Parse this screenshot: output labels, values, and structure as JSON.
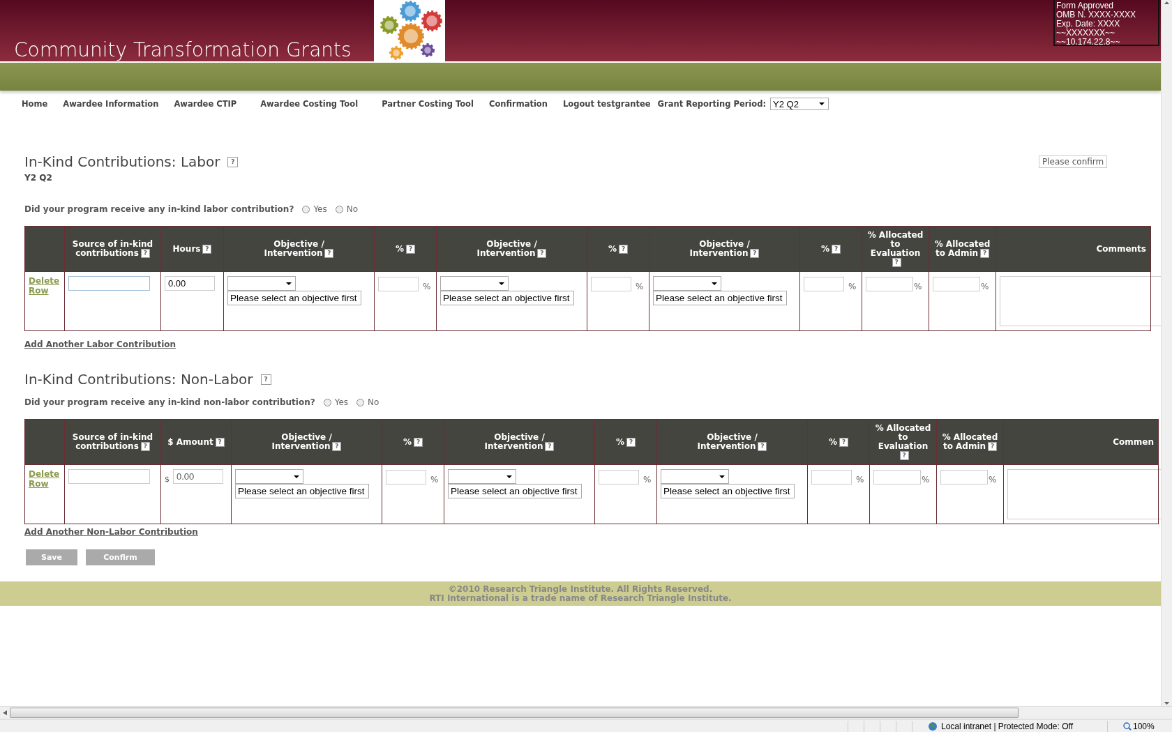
{
  "header": {
    "title": "Community Transformation Grants",
    "form_info": [
      "Form Approved",
      "OMB N. XXXX-XXXX",
      "Exp. Date: XXXX",
      "~~XXXXXXX~~",
      "~~10.174.22.8~~"
    ]
  },
  "nav": {
    "items": [
      {
        "label": "Home"
      },
      {
        "label": "Awardee Information"
      },
      {
        "label": "Awardee CTIP"
      },
      {
        "label": "Awardee Costing Tool"
      },
      {
        "label": "Partner Costing Tool"
      },
      {
        "label": "Confirmation"
      },
      {
        "label": "Logout testgrantee"
      }
    ],
    "period_label": "Grant Reporting Period:",
    "period_value": "Y2 Q2"
  },
  "confirm_notice": "Please confirm",
  "sections": [
    {
      "title": "In-Kind Contributions: Labor",
      "help": "?",
      "subtitle": "Y2 Q2",
      "question": "Did your program receive any in-kind labor contribution?",
      "options": [
        {
          "label": "Yes",
          "selected": false
        },
        {
          "label": "No",
          "selected": false
        }
      ],
      "columns": [
        {
          "label": "Source of in-kind contributions",
          "help": "?"
        },
        {
          "label": "Hours",
          "help": "?"
        },
        {
          "label": "Objective / Intervention",
          "help": "?"
        },
        {
          "label": "%",
          "help": "?"
        },
        {
          "label": "Objective / Intervention",
          "help": "?"
        },
        {
          "label": "%",
          "help": "?"
        },
        {
          "label": "Objective / Intervention",
          "help": "?"
        },
        {
          "label": "%",
          "help": "?"
        },
        {
          "label": "% Allocated to Evaluation",
          "help": "?"
        },
        {
          "label": "% Allocated to Admin",
          "help": "?"
        },
        {
          "label": "Comments"
        }
      ],
      "rows": [
        {
          "action": "Delete Row",
          "cells": [
            {
              "kind": "text",
              "focused": true
            },
            {
              "kind": "number",
              "value": "0.00"
            },
            {
              "kind": "objective",
              "value": "Please select an objective first"
            },
            {
              "kind": "percent",
              "unit": "%"
            },
            {
              "kind": "objective",
              "value": "Please select an objective first"
            },
            {
              "kind": "percent",
              "unit": "%"
            },
            {
              "kind": "objective",
              "value": "Please select an objective first"
            },
            {
              "kind": "percent",
              "unit": "%"
            },
            {
              "kind": "allocation",
              "unit": "%"
            },
            {
              "kind": "allocation",
              "unit": "%"
            },
            {
              "kind": "comments"
            }
          ]
        }
      ],
      "add_link": "Add Another Labor Contribution"
    },
    {
      "title": "In-Kind Contributions: Non-Labor",
      "help": "?",
      "question": "Did your program receive any in-kind non-labor contribution?",
      "options": [
        {
          "label": "Yes",
          "selected": false
        },
        {
          "label": "No",
          "selected": false
        }
      ],
      "columns": [
        {
          "label": "Source of in-kind contributions",
          "help": "?"
        },
        {
          "label": "$ Amount",
          "help": "?"
        },
        {
          "label": "Objective / Intervention",
          "help": "?"
        },
        {
          "label": "%",
          "help": "?"
        },
        {
          "label": "Objective / Intervention",
          "help": "?"
        },
        {
          "label": "%",
          "help": "?"
        },
        {
          "label": "Objective / Intervention",
          "help": "?"
        },
        {
          "label": "%",
          "help": "?"
        },
        {
          "label": "% Allocated to Evaluation",
          "help": "?"
        },
        {
          "label": "% Allocated to Admin",
          "help": "?"
        },
        {
          "label": "Commen"
        }
      ],
      "rows": [
        {
          "action": "Delete Row",
          "cells": [
            {
              "kind": "text",
              "focused": false
            },
            {
              "kind": "money",
              "prefix": "$",
              "value": "0.00"
            },
            {
              "kind": "objective",
              "value": "Please select an objective first"
            },
            {
              "kind": "percent",
              "unit": "%"
            },
            {
              "kind": "objective",
              "value": "Please select an objective first"
            },
            {
              "kind": "percent",
              "unit": "%"
            },
            {
              "kind": "objective",
              "value": "Please select an objective first"
            },
            {
              "kind": "percent",
              "unit": "%"
            },
            {
              "kind": "allocation",
              "unit": "%"
            },
            {
              "kind": "allocation",
              "unit": "%"
            },
            {
              "kind": "comments"
            }
          ]
        }
      ],
      "add_link": "Add Another Non-Labor Contribution"
    }
  ],
  "buttons": [
    {
      "label": "Save"
    },
    {
      "label": "Confirm"
    }
  ],
  "footer": [
    "©2010 Research Triangle Institute. All Rights Reserved.",
    "RTI International is a trade name of Research Triangle Institute."
  ],
  "status_bar": {
    "zone": "Local intranet | Protected Mode: Off",
    "zoom": "100%"
  }
}
